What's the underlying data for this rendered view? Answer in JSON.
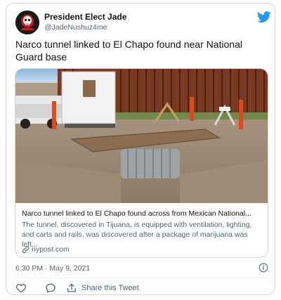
{
  "author": {
    "display_name": "President Elect Jade",
    "handle": "@JadeNushuz4me",
    "avatar_icon": "skull-avatar"
  },
  "platform_icon": "twitter-bird-icon",
  "tweet": {
    "text": "Narco tunnel linked to El Chapo found near National Guard base"
  },
  "link_card": {
    "title": "Narco tunnel linked to El Chapo found across from Mexican National...",
    "description": "The tunnel, discovered in Tijuana, is equipped with ventilation, lighting, and carts and rails, was discovered after a package of marijuana was left...",
    "domain": "nypost.com",
    "domain_icon": "link-icon"
  },
  "timestamp": "6:30 PM · May 9, 2021",
  "actions": {
    "reply_icon": "heart-icon",
    "comment_icon": "reply-icon",
    "share_label": "Share this Tweet",
    "share_icon": "share-icon"
  },
  "colors": {
    "twitter_blue": "#1d9bf0",
    "text_primary": "#0f1419",
    "text_secondary": "#536471",
    "border": "#cfd9de"
  }
}
